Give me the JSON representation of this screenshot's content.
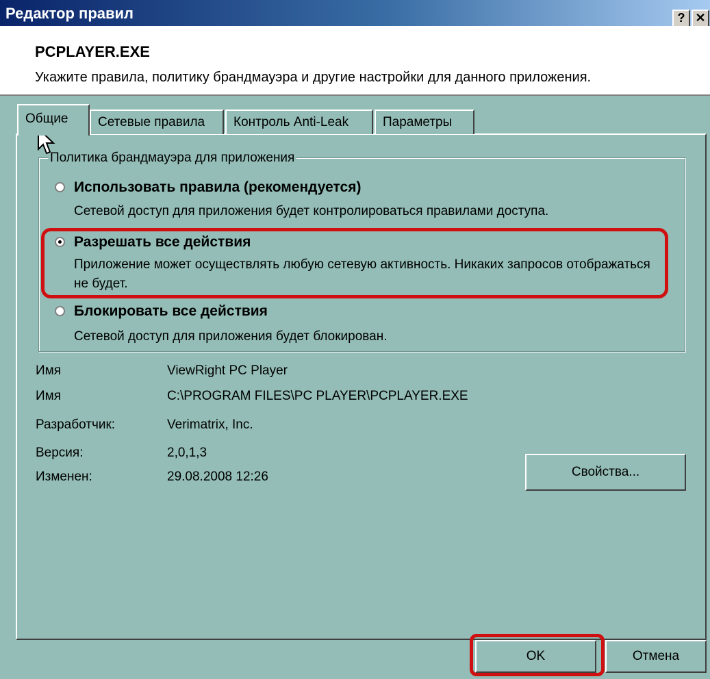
{
  "window": {
    "title": "Редактор правил",
    "help_label": "?",
    "close_label": "✕"
  },
  "header": {
    "app_name": "PCPLAYER.EXE",
    "description": "Укажите правила, политику брандмауэра и другие настройки для данного приложения."
  },
  "tabs": [
    {
      "label": "Общие",
      "active": true
    },
    {
      "label": "Сетевые правила",
      "active": false
    },
    {
      "label": "Контроль Anti-Leak",
      "active": false
    },
    {
      "label": "Параметры",
      "active": false
    }
  ],
  "policy": {
    "group_title": "Политика брандмауэра для приложения",
    "options": [
      {
        "label": "Использовать правила (рекомендуется)",
        "description": "Сетевой доступ для приложения будет контролироваться правилами доступа.",
        "selected": false
      },
      {
        "label": "Разрешать все действия",
        "description": "Приложение может осуществлять любую сетевую активность. Никаких запросов отображаться не будет.",
        "selected": true
      },
      {
        "label": "Блокировать все действия",
        "description": "Сетевой доступ для приложения будет блокирован.",
        "selected": false
      }
    ]
  },
  "info": [
    {
      "label": "Имя",
      "value": "ViewRight PC Player"
    },
    {
      "label": "Имя",
      "value": "C:\\PROGRAM FILES\\PC PLAYER\\PCPLAYER.EXE"
    },
    {
      "label": "Разработчик:",
      "value": "Verimatrix, Inc."
    },
    {
      "label": "Версия:",
      "value": "2,0,1,3"
    },
    {
      "label": "Изменен:",
      "value": "29.08.2008 12:26"
    }
  ],
  "buttons": {
    "properties": "Свойства...",
    "ok": "OK",
    "cancel": "Отмена"
  },
  "colors": {
    "face": "#93bdb6",
    "highlight": "#d01010",
    "title_start": "#0a246a",
    "title_end": "#a6caf0"
  }
}
